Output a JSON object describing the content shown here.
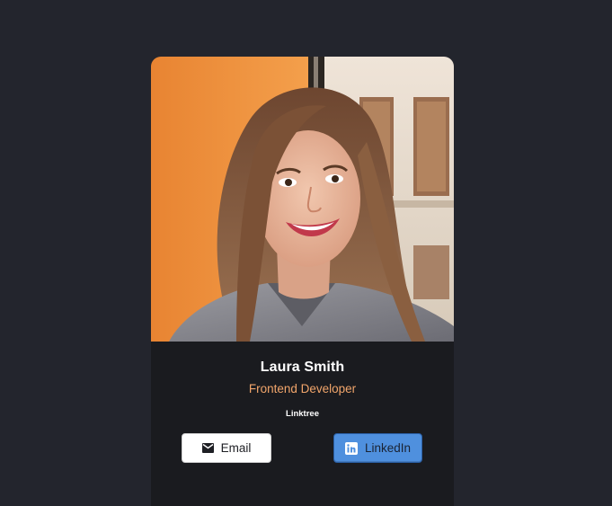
{
  "profile": {
    "name": "Laura Smith",
    "role": "Frontend Developer",
    "linktree": "Linktree"
  },
  "buttons": {
    "email_label": "Email",
    "linkedin_label": "LinkedIn"
  },
  "icons": {
    "email": "envelope-icon",
    "linkedin": "linkedin-icon"
  },
  "colors": {
    "page_background": "#23252d",
    "card_background": "#1a1b1f",
    "role_text": "#f1a56b",
    "linkedin_button": "#4f90de"
  }
}
